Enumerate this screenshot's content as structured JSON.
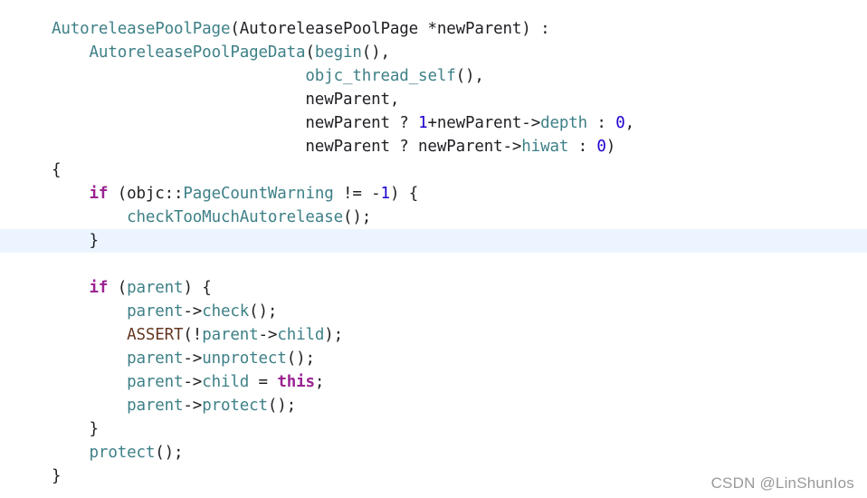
{
  "theme": {
    "background": "#ffffff",
    "highlight_line_bg": "#ecf5ff",
    "plain": "#1f1f24",
    "type_color": "#3e8087",
    "keyword_color": "#9b2393",
    "number_color": "#1c00cf",
    "macro_color": "#643820"
  },
  "highlighted_line": 10,
  "code_lines": [
    [
      [
        "t",
        "AutoreleasePoolPage"
      ],
      [
        "p",
        "(AutoreleasePoolPage *newParent) :"
      ]
    ],
    [
      [
        "p",
        "    "
      ],
      [
        "t",
        "AutoreleasePoolPageData"
      ],
      [
        "p",
        "("
      ],
      [
        "c",
        "begin"
      ],
      [
        "p",
        "(),"
      ]
    ],
    [
      [
        "p",
        "                           "
      ],
      [
        "c",
        "objc_thread_self"
      ],
      [
        "p",
        "(),"
      ]
    ],
    [
      [
        "p",
        "                           newParent,"
      ]
    ],
    [
      [
        "p",
        "                           newParent ? "
      ],
      [
        "n",
        "1"
      ],
      [
        "p",
        "+newParent->"
      ],
      [
        "v",
        "depth"
      ],
      [
        "p",
        " : "
      ],
      [
        "n",
        "0"
      ],
      [
        "p",
        ","
      ]
    ],
    [
      [
        "p",
        "                           newParent ? newParent->"
      ],
      [
        "v",
        "hiwat"
      ],
      [
        "p",
        " : "
      ],
      [
        "n",
        "0"
      ],
      [
        "p",
        ")"
      ]
    ],
    [
      [
        "p",
        "{"
      ]
    ],
    [
      [
        "p",
        "    "
      ],
      [
        "k",
        "if"
      ],
      [
        "p",
        " (objc::"
      ],
      [
        "t",
        "PageCountWarning"
      ],
      [
        "p",
        " != -"
      ],
      [
        "n",
        "1"
      ],
      [
        "p",
        ") {"
      ]
    ],
    [
      [
        "p",
        "        "
      ],
      [
        "c",
        "checkTooMuchAutorelease"
      ],
      [
        "p",
        "();"
      ]
    ],
    [
      [
        "p",
        "    }"
      ]
    ],
    [
      [
        "p",
        ""
      ]
    ],
    [
      [
        "p",
        "    "
      ],
      [
        "k",
        "if"
      ],
      [
        "p",
        " ("
      ],
      [
        "v",
        "parent"
      ],
      [
        "p",
        ") {"
      ]
    ],
    [
      [
        "p",
        "        "
      ],
      [
        "v",
        "parent"
      ],
      [
        "p",
        "->"
      ],
      [
        "c",
        "check"
      ],
      [
        "p",
        "();"
      ]
    ],
    [
      [
        "p",
        "        "
      ],
      [
        "m",
        "ASSERT"
      ],
      [
        "p",
        "(!"
      ],
      [
        "v",
        "parent"
      ],
      [
        "p",
        "->"
      ],
      [
        "v",
        "child"
      ],
      [
        "p",
        ");"
      ]
    ],
    [
      [
        "p",
        "        "
      ],
      [
        "v",
        "parent"
      ],
      [
        "p",
        "->"
      ],
      [
        "c",
        "unprotect"
      ],
      [
        "p",
        "();"
      ]
    ],
    [
      [
        "p",
        "        "
      ],
      [
        "v",
        "parent"
      ],
      [
        "p",
        "->"
      ],
      [
        "v",
        "child"
      ],
      [
        "p",
        " = "
      ],
      [
        "k",
        "this"
      ],
      [
        "p",
        ";"
      ]
    ],
    [
      [
        "p",
        "        "
      ],
      [
        "v",
        "parent"
      ],
      [
        "p",
        "->"
      ],
      [
        "c",
        "protect"
      ],
      [
        "p",
        "();"
      ]
    ],
    [
      [
        "p",
        "    }"
      ]
    ],
    [
      [
        "p",
        "    "
      ],
      [
        "c",
        "protect"
      ],
      [
        "p",
        "();"
      ]
    ],
    [
      [
        "p",
        "}"
      ]
    ]
  ],
  "watermark": "CSDN @LinShunIos"
}
